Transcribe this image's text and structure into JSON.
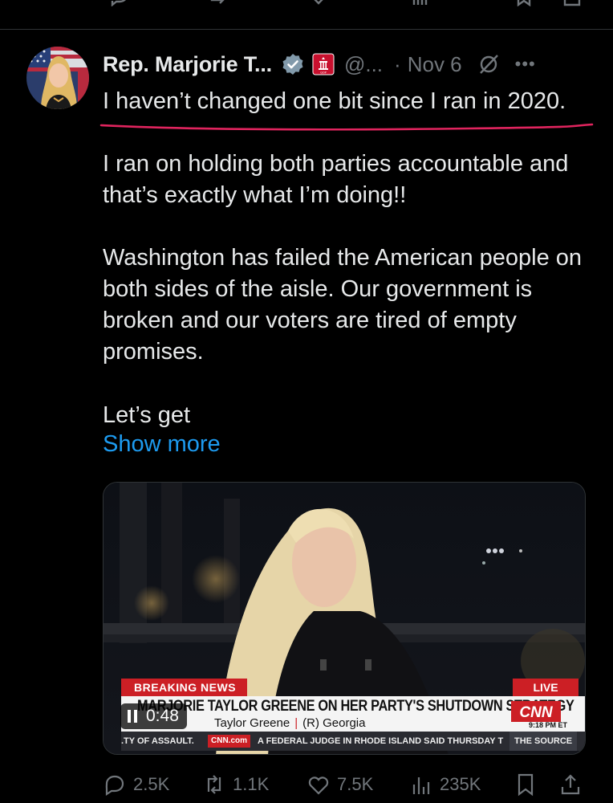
{
  "post": {
    "author_name": "Rep. Marjorie T...",
    "handle": "@...",
    "separator": "·",
    "date": "Nov 6",
    "more_label": "•••",
    "first_line": "I haven’t changed one bit since I ran in 2020.",
    "paragraphs": [
      "I ran on holding both parties accountable and that’s exactly what I’m doing!!",
      "Washington has failed the American people on both sides of the aisle. Our government is broken and our voters are tired of empty promises.",
      "Let’s get"
    ],
    "show_more": "Show more"
  },
  "video": {
    "breaking_label": "BREAKING NEWS",
    "live_label": "LIVE",
    "headline": "MARJORIE TAYLOR GREENE ON HER PARTY'S SHUTDOWN STRATEGY",
    "subline_name": "Taylor Greene",
    "subline_pipe": "|",
    "subline_party": "(R) Georgia",
    "network_logo": "CNN",
    "time_et": "9:18 PM ET",
    "ticker_left": ".TY OF ASSAULT.",
    "ticker_site": "CNN.com",
    "ticker_text": "A FEDERAL JUDGE IN RHODE ISLAND SAID THURSDAY T",
    "ticker_source": "THE SOURCE",
    "elapsed": "0:48"
  },
  "engagement": {
    "replies": "2.5K",
    "reposts": "1.1K",
    "likes": "7.5K",
    "views": "235K"
  },
  "colors": {
    "background": "#000000",
    "text": "#e7e9ea",
    "muted": "#71767b",
    "link": "#1d9bf0",
    "verified": "#829aab",
    "annotation_underline": "#e0245e",
    "news_red": "#cc1f25"
  },
  "icons": {
    "verified": "verified-badge-icon",
    "government": "government-affiliation-icon",
    "grok": "grok-icon",
    "reply": "reply-icon",
    "repost": "repost-icon",
    "like": "heart-icon",
    "views": "views-chart-icon",
    "bookmark": "bookmark-icon",
    "share": "share-icon"
  }
}
